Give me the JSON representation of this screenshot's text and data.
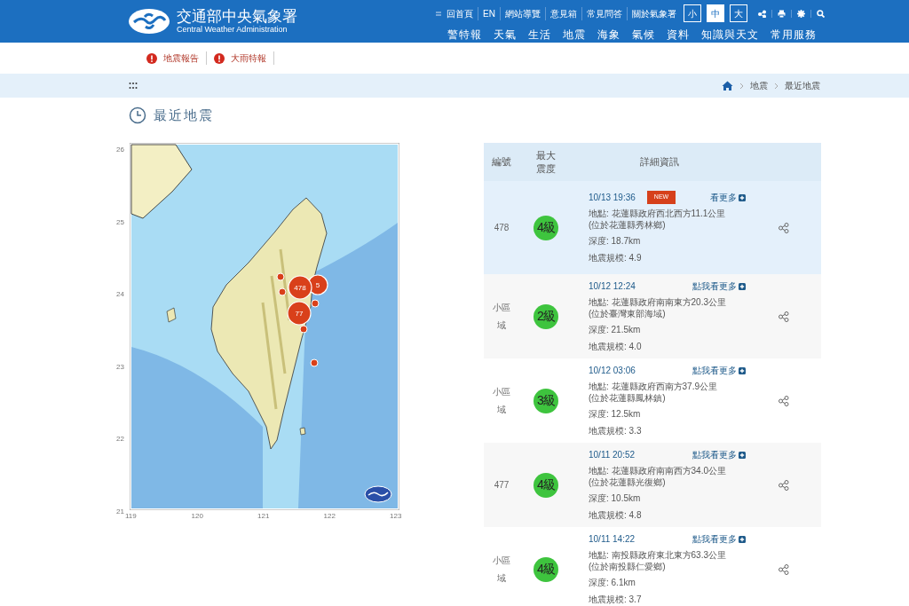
{
  "header": {
    "logo_title": "交通部中央氣象署",
    "logo_subtitle": "Central Weather Administration",
    "top_links": [
      "回首頁",
      "EN",
      "網站導覽",
      "意見箱",
      "常見問答",
      "關於氣象署"
    ],
    "font_sizes": [
      {
        "label": "小",
        "selected": false
      },
      {
        "label": "中",
        "selected": true
      },
      {
        "label": "大",
        "selected": false
      }
    ],
    "nav": [
      "警特報",
      "天氣",
      "生活",
      "地震",
      "海象",
      "氣候",
      "資料",
      "知識與天文",
      "常用服務"
    ]
  },
  "alerts": [
    "地震報告",
    "大雨特報"
  ],
  "breadcrumb": [
    "地震",
    "最近地震"
  ],
  "page_title": "最近地震",
  "map": {
    "lat_labels": [
      "26",
      "25",
      "24",
      "23",
      "22",
      "21"
    ],
    "lon_labels": [
      "119",
      "120",
      "121",
      "122",
      "123"
    ],
    "markers": [
      {
        "label": "5"
      },
      {
        "label": "77"
      },
      {
        "label": "478"
      }
    ]
  },
  "table": {
    "columns": [
      "編號",
      "最大震度",
      "詳細資訊"
    ],
    "rows": [
      {
        "number": "478",
        "intensity": "4級",
        "time": "10/13 19:36",
        "badge": "NEW",
        "more_link": "看更多",
        "location": "地點: 花蓮縣政府西北西方11.1公里",
        "sublocation": "(位於花蓮縣秀林鄉)",
        "depth": "深度: 18.7km",
        "magnitude": "地震規模: 4.9",
        "highlighted": true
      },
      {
        "number": "小區域",
        "intensity": "2級",
        "time": "10/12 12:24",
        "more_link": "點我看更多",
        "location": "地點: 花蓮縣政府南南東方20.3公里",
        "sublocation": "(位於臺灣東部海域)",
        "depth": "深度: 21.5km",
        "magnitude": "地震規模: 4.0",
        "highlighted": false
      },
      {
        "number": "小區域",
        "intensity": "3級",
        "time": "10/12 03:06",
        "more_link": "點我看更多",
        "location": "地點: 花蓮縣政府西南方37.9公里",
        "sublocation": "(位於花蓮縣鳳林鎮)",
        "depth": "深度: 12.5km",
        "magnitude": "地震規模: 3.3",
        "highlighted": false
      },
      {
        "number": "477",
        "intensity": "4級",
        "time": "10/11 20:52",
        "more_link": "點我看更多",
        "location": "地點: 花蓮縣政府南南西方34.0公里",
        "sublocation": "(位於花蓮縣光復鄉)",
        "depth": "深度: 10.5km",
        "magnitude": "地震規模: 4.8",
        "highlighted": false
      },
      {
        "number": "小區域",
        "intensity": "4級",
        "time": "10/11 14:22",
        "more_link": "點我看更多",
        "location": "地點: 南投縣政府東北東方63.3公里",
        "sublocation": "(位於南投縣仁愛鄉)",
        "depth": "深度: 6.1km",
        "magnitude": "地震規模: 3.7",
        "highlighted": false
      }
    ]
  }
}
